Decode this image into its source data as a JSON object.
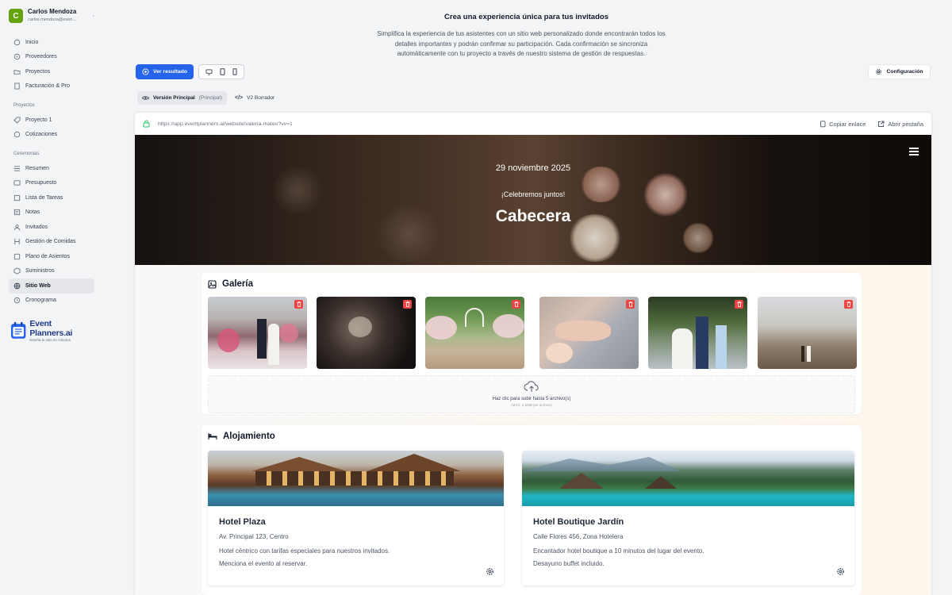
{
  "sidebar": {
    "user": {
      "initial": "C",
      "name": "Carlos Mendoza",
      "email": "carlos.mendoza@even..."
    },
    "main_items": [
      {
        "label": "Inicio",
        "icon": "home-icon"
      },
      {
        "label": "Proveedores",
        "icon": "compass-icon"
      },
      {
        "label": "Proyectos",
        "icon": "folder-icon"
      },
      {
        "label": "Facturación & Pro",
        "icon": "invoice-icon"
      }
    ],
    "projects_section": "Proyectos",
    "project_items": [
      {
        "label": "Proyecto 1",
        "icon": "tag-icon"
      },
      {
        "label": "Cotizaciones",
        "icon": "circle-icon"
      }
    ],
    "ceremonies_section": "Ceremonias",
    "ceremony_items": [
      {
        "label": "Resumen",
        "icon": "list-icon"
      },
      {
        "label": "Presupuesto",
        "icon": "budget-icon"
      },
      {
        "label": "Lista de Tareas",
        "icon": "checklist-icon"
      },
      {
        "label": "Notas",
        "icon": "notes-icon"
      },
      {
        "label": "Invitados",
        "icon": "users-icon"
      },
      {
        "label": "Gestión de Comidas",
        "icon": "food-icon"
      },
      {
        "label": "Plano de Asientos",
        "icon": "seat-icon"
      },
      {
        "label": "Suministros",
        "icon": "box-icon"
      },
      {
        "label": "Sitio Web",
        "icon": "globe-icon",
        "active": true
      },
      {
        "label": "Cronograma",
        "icon": "clock-icon"
      }
    ],
    "brand": {
      "name": "Event Planners.ai",
      "tagline": "Diseña tu sitio en minutos"
    }
  },
  "header": {
    "title": "Crea una experiencia única para tus invitados",
    "description": "Simplifica la experiencia de tus asistentes con un sitio web personalizado donde encontrarán todos los detalles importantes y podrán confirmar su participación. Cada confirmación se sincroniza automáticamente con tu proyecto a través de nuestro sistema de gestión de respuestas."
  },
  "toolbar": {
    "view_result": "Ver resultado",
    "config": "Configuración",
    "devices": [
      "desktop-icon",
      "tablet-icon",
      "mobile-icon"
    ]
  },
  "versions": {
    "main_label": "Versión Principal",
    "main_badge": "(Principal)",
    "draft_label": "V2 Borrador"
  },
  "browser": {
    "url": "https://app.eventplanners.ai/website/valeria-mateo?vv=1",
    "copy_link": "Copiar enlace",
    "open_tab": "Abrir pestaña"
  },
  "hero": {
    "date": "29 noviembre 2025",
    "subtitle": "¡Celebremos juntos!",
    "title": "Cabecera"
  },
  "gallery": {
    "title": "Galería",
    "upload_text": "Haz clic para subir hasta 5 archivo(s)",
    "upload_hint": "(MAX. 2.5MB por archivo)",
    "photos": [
      "photo-couple-flowers",
      "photo-dark-flowers",
      "photo-chair-aisle",
      "photo-holding-hands",
      "photo-wedding-party",
      "photo-couple-mountains"
    ]
  },
  "lodging": {
    "title": "Alojamiento",
    "hotels": [
      {
        "name": "Hotel Plaza",
        "address": "Av. Principal 123, Centro",
        "description": "Hotel céntrico con tarifas especiales para nuestros invitados. Menciona el evento al reservar."
      },
      {
        "name": "Hotel Boutique Jardín",
        "address": "Calle Flores 456, Zona Hotelera",
        "description": "Encantador hotel boutique a 10 minutos del lugar del evento. Desayuno buffet incluido."
      }
    ]
  },
  "colors": {
    "primary": "#2563eb",
    "brand_green": "#65a30d",
    "delete": "#ef4444"
  }
}
